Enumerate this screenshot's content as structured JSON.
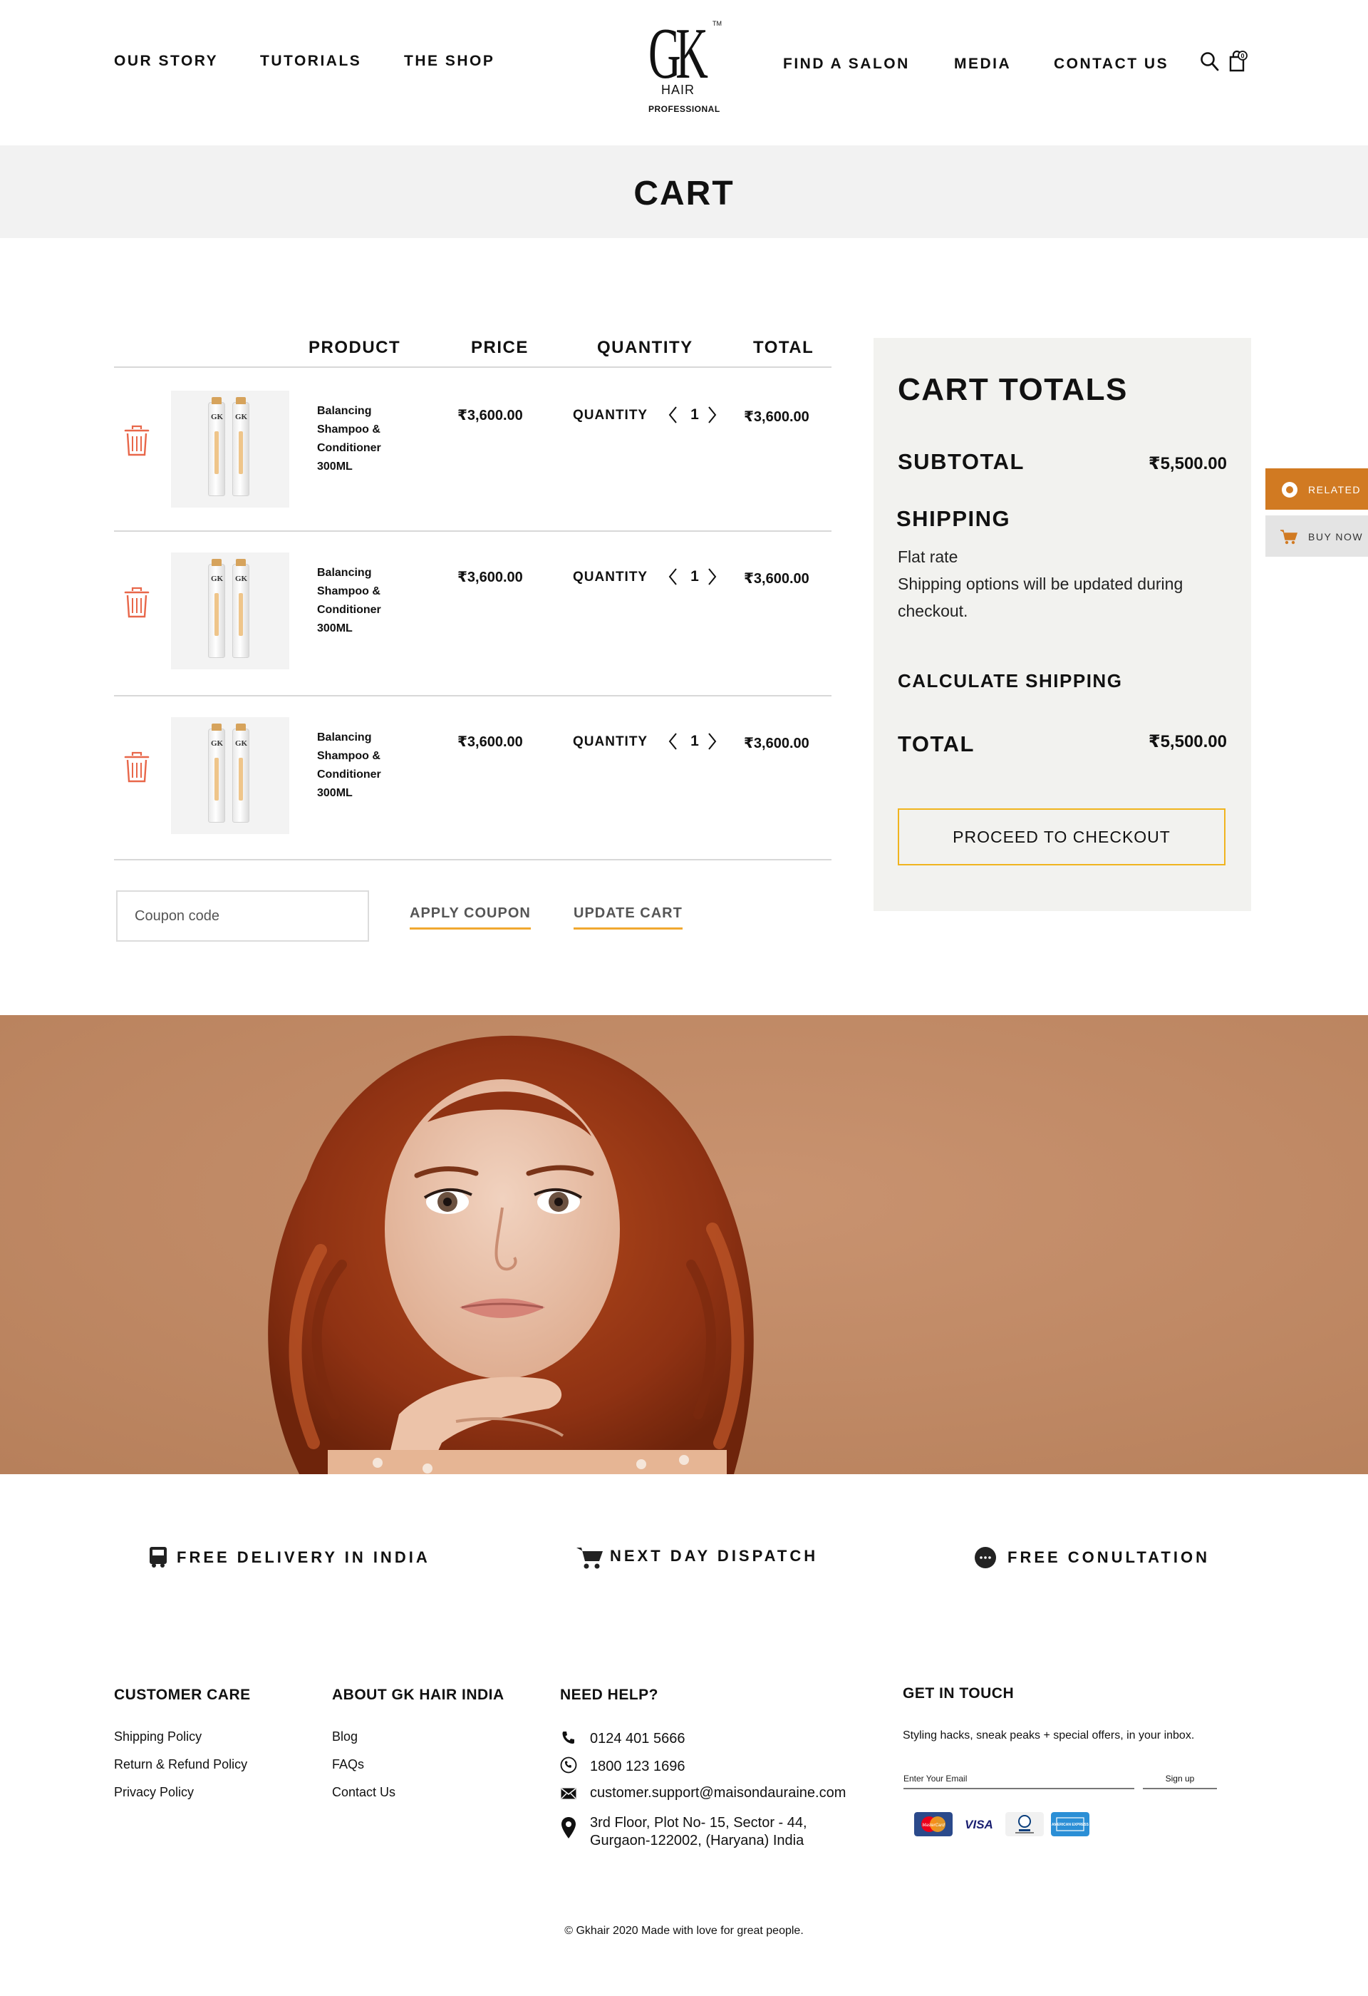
{
  "nav": {
    "left": [
      "OUR STORY",
      "TUTORIALS",
      "THE SHOP"
    ],
    "right": [
      "FIND A SALON",
      "MEDIA",
      "CONTACT US"
    ]
  },
  "logo": {
    "mark": "GK",
    "sub": "HAIR",
    "tagline": "PROFESSIONAL",
    "tm": "TM"
  },
  "page_title": "CART",
  "table": {
    "headers": [
      "PRODUCT",
      "PRICE",
      "QUANTITY",
      "TOTAL"
    ],
    "rows": [
      {
        "name": "Balancing Shampoo & Conditioner 300ML",
        "price": "₹3,600.00",
        "quantity_label": "QUANTITY",
        "quantity": "1",
        "total": "₹3,600.00"
      },
      {
        "name": "Balancing Shampoo & Conditioner 300ML",
        "price": "₹3,600.00",
        "quantity_label": "QUANTITY",
        "quantity": "1",
        "total": "₹3,600.00"
      },
      {
        "name": "Balancing Shampoo & Conditioner 300ML",
        "price": "₹3,600.00",
        "quantity_label": "QUANTITY",
        "quantity": "1",
        "total": "₹3,600.00"
      }
    ]
  },
  "coupon": {
    "placeholder": "Coupon code",
    "apply_label": "APPLY COUPON",
    "update_label": "UPDATE CART"
  },
  "totals": {
    "title": "CART TOTALS",
    "subtotal_label": "SUBTOTAL",
    "subtotal_value": "₹5,500.00",
    "shipping_label": "SHIPPING",
    "shipping_method": "Flat rate",
    "shipping_note_1": "Shipping options will be updated during",
    "shipping_note_2": "checkout.",
    "calculate_label": "CALCULATE SHIPPING",
    "total_label": "TOTAL",
    "total_value": "₹5,500.00",
    "checkout_label": "PROCEED TO CHECKOUT"
  },
  "side_tabs": {
    "related": "RELATED",
    "buy_now": "BUY NOW"
  },
  "features": [
    "FREE DELIVERY IN INDIA",
    "NEXT DAY DISPATCH",
    "FREE CONULTATION"
  ],
  "footer": {
    "customer_care": {
      "heading": "CUSTOMER CARE",
      "links": [
        "Shipping Policy",
        "Return & Refund Policy",
        "Privacy Policy"
      ]
    },
    "about": {
      "heading": "ABOUT GK HAIR INDIA",
      "links": [
        "Blog",
        "FAQs",
        "Contact Us"
      ]
    },
    "help": {
      "heading": "NEED HELP?",
      "phone1": "0124 401 5666",
      "phone2": "1800 123 1696",
      "email": "customer.support@maisondauraine.com",
      "address_1": "3rd Floor, Plot No- 15, Sector - 44,",
      "address_2": "Gurgaon-122002, (Haryana) India"
    },
    "contact": {
      "heading": "GET IN TOUCH",
      "text": "Styling hacks, sneak peaks + special offers, in your inbox.",
      "email_placeholder": "Enter Your Email",
      "signup_label": "Sign up"
    },
    "payments": [
      "mastercard-icon",
      "visa-icon",
      "diners-club-icon",
      "american-express-icon"
    ],
    "payment_labels": {
      "visa": "VISA",
      "mastercard": "MasterCard",
      "amex": "AMERICAN EXPRESS"
    },
    "copyright": "© Gkhair 2020 Made with love for great people."
  },
  "colors": {
    "accent": "#f0a830",
    "trash": "#e8674a",
    "tab_orange": "#d17a22",
    "band": "#f2f2f2",
    "hero": "#c38a64"
  }
}
